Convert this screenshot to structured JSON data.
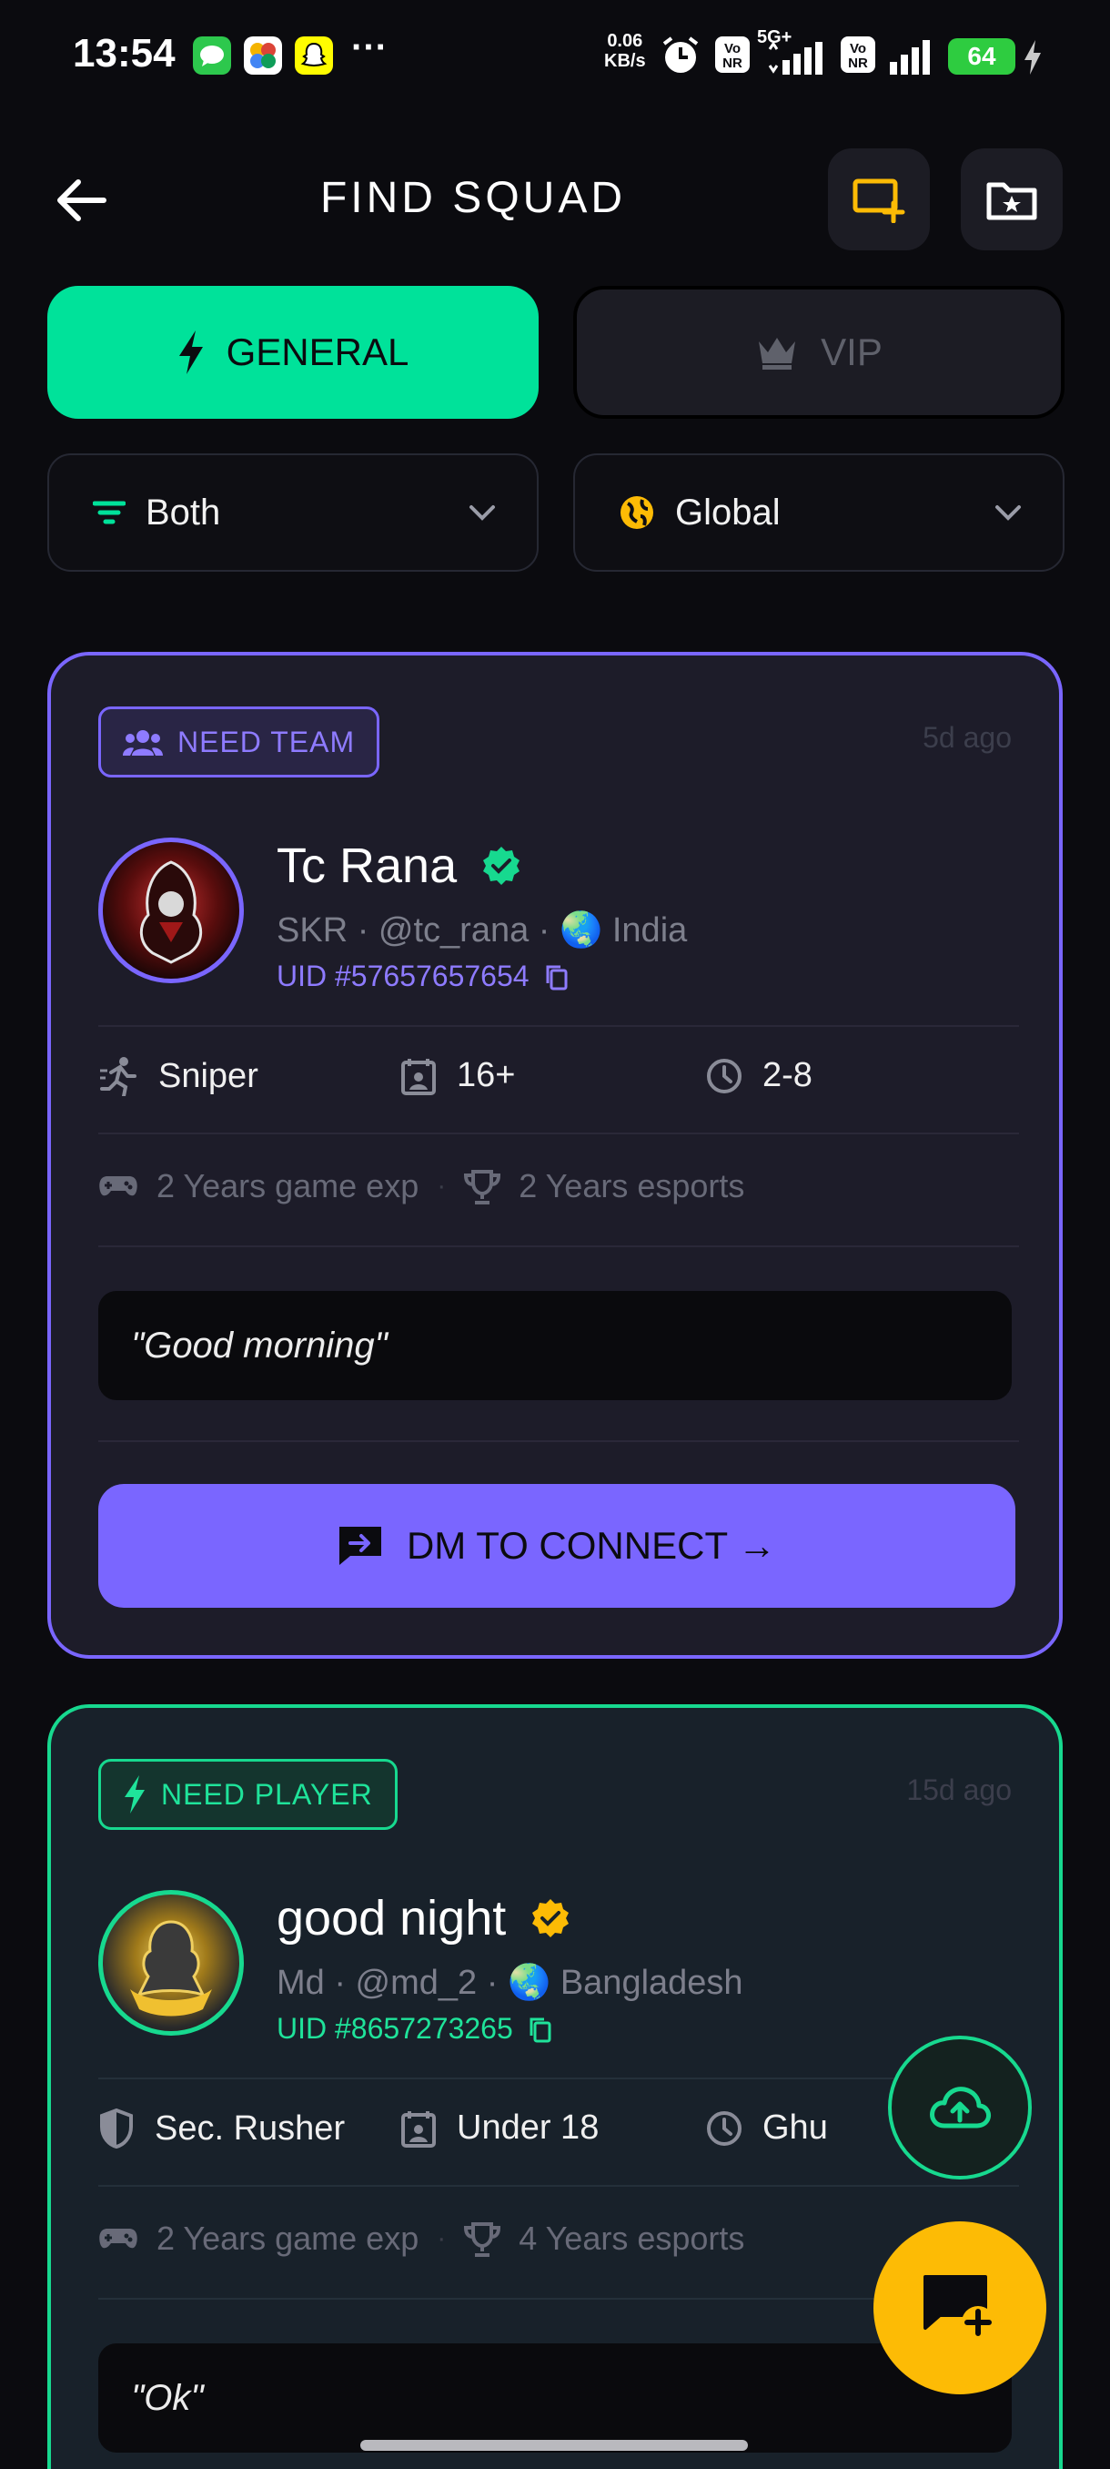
{
  "status_bar": {
    "time": "13:54",
    "net_speed_value": "0.06",
    "net_speed_unit": "KB/s",
    "network_label": "5G+",
    "volte_label": "Vo NR",
    "battery": "64",
    "more_dots": "···"
  },
  "header": {
    "title": "FIND SQUAD"
  },
  "tabs": [
    {
      "label": "GENERAL",
      "active": true
    },
    {
      "label": "VIP",
      "active": false
    }
  ],
  "filters": {
    "mode": "Both",
    "region": "Global"
  },
  "posts": [
    {
      "badge": "NEED TEAM",
      "time_ago": "5d ago",
      "name": "Tc Rana",
      "verified_color": "#17d98f",
      "meta": "SKR · @tc_rana · 🌏 India",
      "uid": "UID #57657657654",
      "role": "Sniper",
      "age": "16+",
      "time_slot": "2-8",
      "game_exp": "2 Years game exp",
      "esports_exp": "2 Years esports",
      "quote": "\"Good morning\"",
      "cta": "DM TO CONNECT →",
      "accent": "#7a66ff"
    },
    {
      "badge": "NEED PLAYER",
      "time_ago": "15d ago",
      "name": "good night",
      "verified_color": "#fdbb05",
      "meta": "Md · @md_2 · 🌏 Bangladesh",
      "uid": "UID #8657273265",
      "role": "Sec. Rusher",
      "age": "Under 18",
      "time_slot": "Ghu",
      "game_exp": "2 Years game exp",
      "esports_exp": "4 Years esports",
      "quote": "\"Ok\"",
      "accent": "#17d98f"
    }
  ]
}
